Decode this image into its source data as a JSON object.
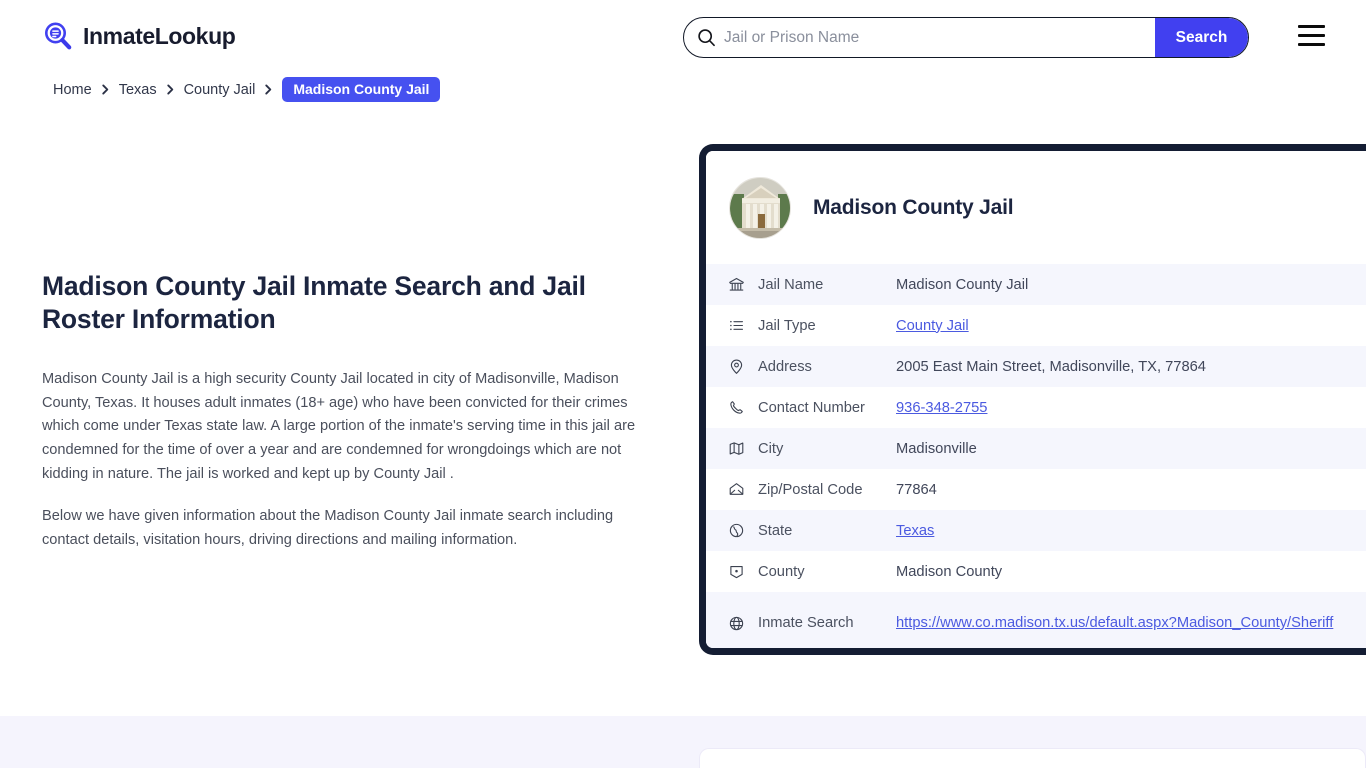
{
  "header": {
    "logo_text": "InmateLookup",
    "logo_icon": "search-list-logo-icon",
    "search": {
      "placeholder": "Jail or Prison Name",
      "value": "",
      "button_label": "Search",
      "icon": "search-icon"
    },
    "menu_icon": "hamburger-menu-icon"
  },
  "breadcrumb": {
    "items": [
      {
        "label": "Home",
        "current": false
      },
      {
        "label": "Texas",
        "current": false
      },
      {
        "label": "County Jail",
        "current": false
      },
      {
        "label": "Madison County Jail",
        "current": true
      }
    ]
  },
  "main": {
    "title": "Madison County Jail Inmate Search and Jail Roster Information",
    "paragraphs": [
      "Madison County Jail is a high security County Jail located in city of Madisonville, Madison County, Texas. It houses adult inmates (18+ age) who have been convicted for their crimes which come under Texas state law. A large portion of the inmate's serving time in this jail are condemned for the time of over a year and are condemned for wrongdoings which are not kidding in nature. The jail is worked and kept up by County Jail .",
      "Below we have given information about the Madison County Jail inmate search including contact details, visitation hours, driving directions and mailing information."
    ]
  },
  "info_card": {
    "avatar_icon": "courthouse-photo",
    "title": "Madison County Jail",
    "rows": [
      {
        "icon": "bank-icon",
        "label": "Jail Name",
        "value": "Madison County Jail",
        "link": false
      },
      {
        "icon": "list-icon",
        "label": "Jail Type",
        "value": "County Jail",
        "link": true
      },
      {
        "icon": "map-pin-icon",
        "label": "Address",
        "value": "2005 East Main Street, Madisonville, TX, 77864",
        "link": false
      },
      {
        "icon": "phone-icon",
        "label": "Contact Number",
        "value": "936-348-2755",
        "link": true
      },
      {
        "icon": "map-icon",
        "label": "City",
        "value": "Madisonville",
        "link": false
      },
      {
        "icon": "envelope-icon",
        "label": "Zip/Postal Code",
        "value": "77864",
        "link": false
      },
      {
        "icon": "globe-icon",
        "label": "State",
        "value": "Texas",
        "link": true
      },
      {
        "icon": "shield-icon",
        "label": "County",
        "value": "Madison County",
        "link": false
      },
      {
        "icon": "web-globe-icon",
        "label": "Inmate Search",
        "value": "https://www.co.madison.tx.us/default.aspx?Madison_County/Sheriff",
        "link": true
      }
    ]
  },
  "colors": {
    "accent_blue": "#4140f0",
    "badge_blue": "#4651f0",
    "link_blue": "#4b5ae0",
    "card_border": "#141d33",
    "row_alt": "#f5f6fd",
    "band": "#f5f4fd",
    "heading": "#1c2540"
  }
}
